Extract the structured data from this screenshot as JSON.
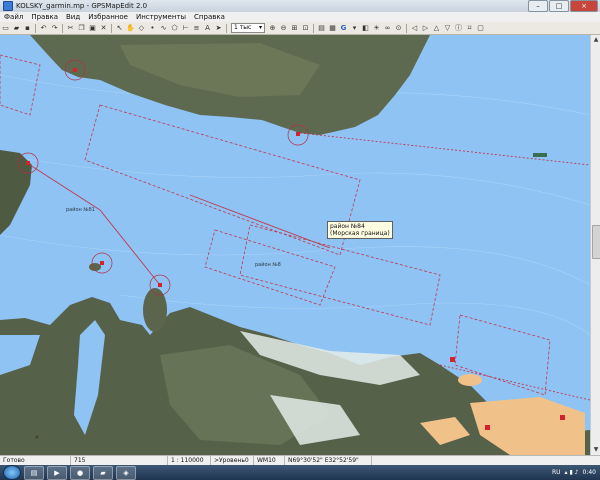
{
  "window": {
    "title": "KOLSKY_garmin.mp - GPSMapEdit 2.0"
  },
  "menu": [
    "Файл",
    "Правка",
    "Вид",
    "Избранное",
    "Инструменты",
    "Справка"
  ],
  "toolbar": {
    "scale_value": "1 тыс"
  },
  "map": {
    "tooltip": {
      "line1": "район №84",
      "line2": "(Морская граница)"
    },
    "labels": {
      "area_a": "район №81",
      "area_b": "район №8"
    }
  },
  "status": {
    "ready": "Готово",
    "code": "715",
    "scale": "1 : 110000",
    "level": ">Уровень0",
    "datum": "WM10",
    "coords": "N69°30'52\" E32°52'59\""
  },
  "taskbar": {
    "lang": "RU",
    "time": "0:40"
  },
  "colors": {
    "sea": "#8fc3f4",
    "land": "#5f6a52",
    "boundary": "#c0394e",
    "tooltip_bg": "#fffde1"
  }
}
